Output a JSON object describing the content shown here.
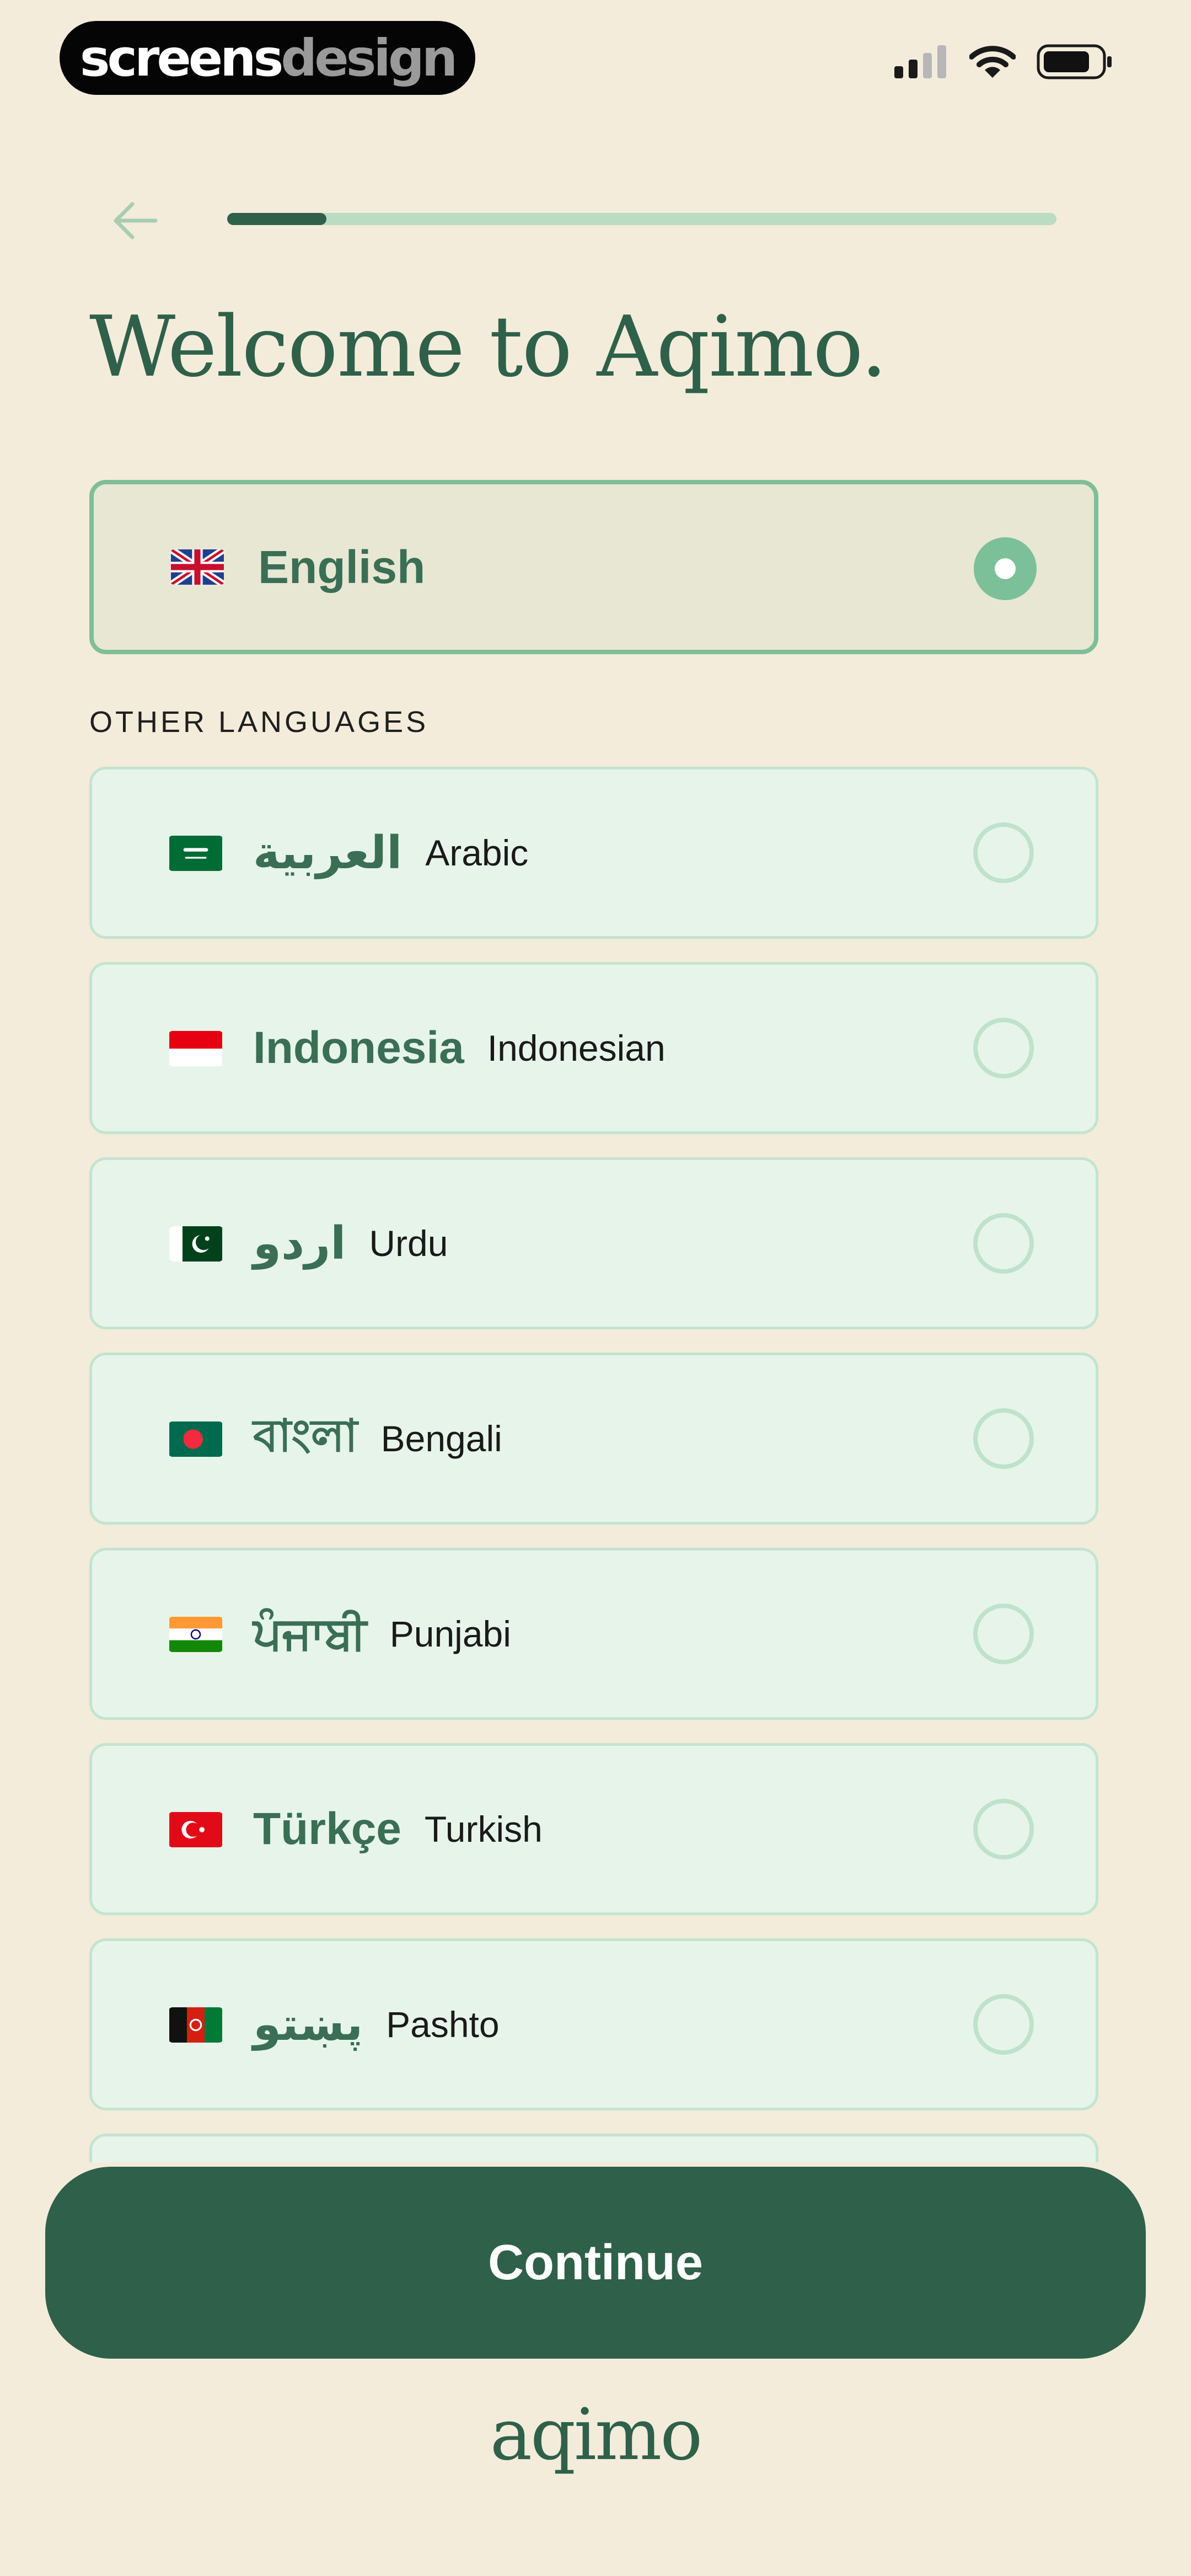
{
  "status_bar": {
    "brand_part1": "screens",
    "brand_part2": "design"
  },
  "onboarding": {
    "progress_fraction": 0.12,
    "title": "Welcome to Aqimo."
  },
  "selected_language": {
    "native": "English",
    "flag": "uk-flag"
  },
  "other_languages": {
    "label": "OTHER LANGUAGES",
    "items": [
      {
        "native": "العربية",
        "english": "Arabic",
        "flag": "saudi-flag"
      },
      {
        "native": "Indonesia",
        "english": "Indonesian",
        "flag": "indonesia-flag"
      },
      {
        "native": "اردو",
        "english": "Urdu",
        "flag": "pakistan-flag"
      },
      {
        "native": "বাংলা",
        "english": "Bengali",
        "flag": "bangladesh-flag"
      },
      {
        "native": "ਪੰਜਾਬੀ",
        "english": "Punjabi",
        "flag": "india-flag"
      },
      {
        "native": "Türkçe",
        "english": "Turkish",
        "flag": "turkey-flag"
      },
      {
        "native": "پښتو",
        "english": "Pashto",
        "flag": "afghanistan-flag"
      }
    ]
  },
  "actions": {
    "continue_label": "Continue"
  },
  "footer": {
    "logo": "aqimo"
  },
  "colors": {
    "background": "#f4ecdb",
    "primary": "#2f6049",
    "accent": "#7cc09a",
    "card": "#e7f4ea"
  }
}
